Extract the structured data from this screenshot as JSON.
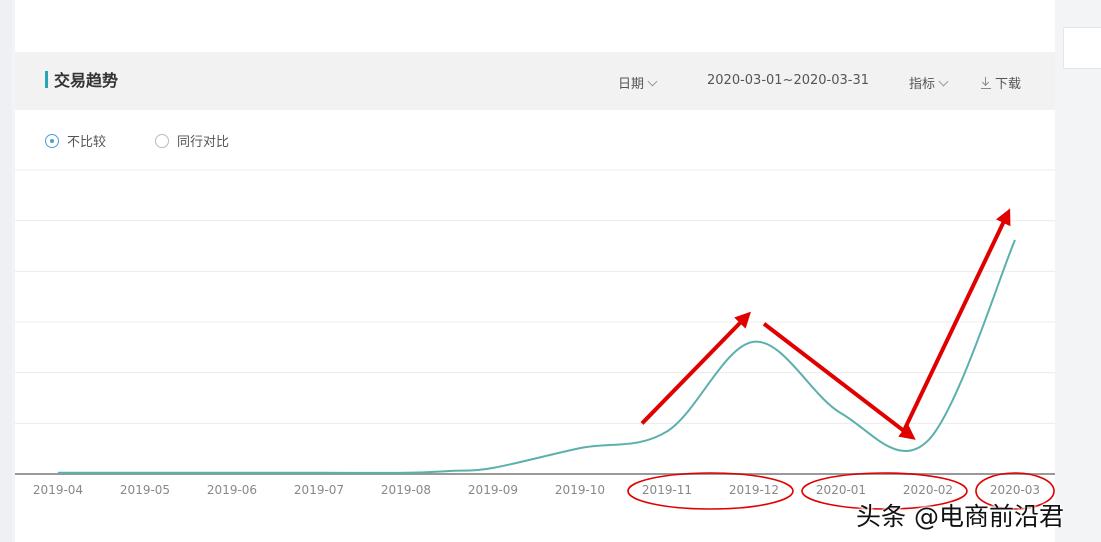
{
  "header": {
    "title": "交易趋势",
    "date_label": "日期",
    "date_range": "2020-03-01~2020-03-31",
    "metric_label": "指标",
    "download_label": "下载"
  },
  "compare": {
    "option_none": "不比较",
    "option_peer": "同行对比",
    "selected": "不比较"
  },
  "watermark": "头条 @电商前沿君",
  "colors": {
    "accent": "#26a6b5",
    "line": "#5bb0ad",
    "annotation": "#e00000"
  },
  "chart_data": {
    "type": "line",
    "title": "交易趋势",
    "categories": [
      "2019-04",
      "2019-05",
      "2019-06",
      "2019-07",
      "2019-08",
      "2019-09",
      "2019-10",
      "2019-11",
      "2019-12",
      "2020-01",
      "2020-02",
      "2020-03"
    ],
    "x": [
      "2019-04",
      "2019-05",
      "2019-06",
      "2019-07",
      "2019-08",
      "2019-08.5",
      "2019-09",
      "2019-10",
      "2019-11",
      "2019-12",
      "2020-01",
      "2020-02",
      "2020-03"
    ],
    "series": [
      {
        "values": [
          0.4,
          0.4,
          0.4,
          0.4,
          0.4,
          1.0,
          2.0,
          8.5,
          14.0,
          43.5,
          20.0,
          11.0,
          77.0
        ]
      }
    ],
    "ylim": [
      0,
      100
    ],
    "grid": true,
    "legend": "none",
    "annotations": {
      "arrows": [
        {
          "from": "2019-11",
          "to": "2019-12",
          "direction": "up"
        },
        {
          "from": "2019-12",
          "to": "2020-02",
          "direction": "down"
        },
        {
          "from": "2020-02",
          "to": "2020-03",
          "direction": "up"
        }
      ],
      "circled_ticks": [
        [
          "2019-11",
          "2019-12"
        ],
        [
          "2020-01",
          "2020-02"
        ],
        [
          "2020-03"
        ]
      ]
    }
  }
}
